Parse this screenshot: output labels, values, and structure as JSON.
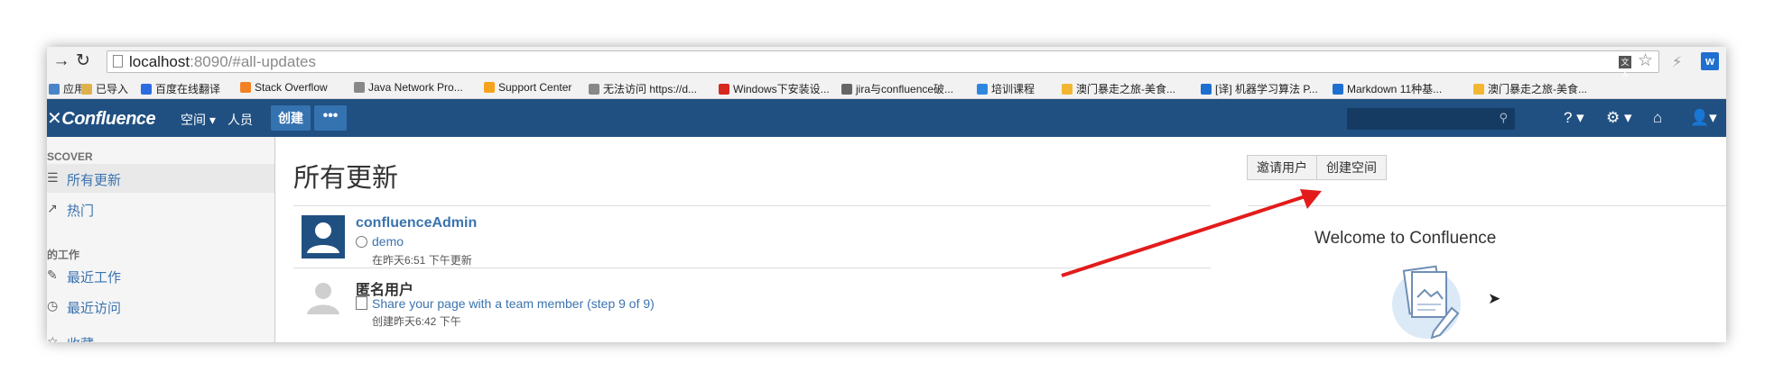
{
  "browser": {
    "url_host": "localhost",
    "url_path": ":8090/#all-updates",
    "translate_icon": "文A",
    "bookmarks": [
      {
        "label": "应用",
        "icon": "apps-icon",
        "color": "#4a86c7"
      },
      {
        "label": "已导入",
        "icon": "folder-icon",
        "color": "#e0b14a"
      },
      {
        "label": "百度在线翻译",
        "icon": "baidu-translate-icon",
        "color": "#2b6de0"
      },
      {
        "label": "Stack Overflow",
        "icon": "stackoverflow-icon",
        "color": "#f48024"
      },
      {
        "label": "Java Network Pro...",
        "icon": "page-icon",
        "color": "#888888"
      },
      {
        "label": "Support Center",
        "icon": "support-icon",
        "color": "#f7a21b"
      },
      {
        "label": "无法访问 https://d...",
        "icon": "page-icon",
        "color": "#888888"
      },
      {
        "label": "Windows下安装设...",
        "icon": "weibo-icon",
        "color": "#d6281f"
      },
      {
        "label": "jira与confluence破...",
        "icon": "bird-icon",
        "color": "#666666"
      },
      {
        "label": "培训课程",
        "icon": "course-icon",
        "color": "#2f86e0"
      },
      {
        "label": "澳门暴走之旅-美食...",
        "icon": "travel-icon",
        "color": "#f2b632"
      },
      {
        "label": "[译] 机器学习算法 P...",
        "icon": "article-icon",
        "color": "#1f6fd0"
      },
      {
        "label": "Markdown 11种基...",
        "icon": "markdown-icon",
        "color": "#1f6fd0"
      },
      {
        "label": "澳门暴走之旅-美食...",
        "icon": "travel-icon",
        "color": "#f2b632"
      }
    ]
  },
  "header": {
    "logo": "Confluence",
    "nav": {
      "spaces": "空间 ▾",
      "people": "人员"
    },
    "create": "创建",
    "more": "•••",
    "search_placeholder": ""
  },
  "sidebar": {
    "discover": "SCOVER",
    "items": [
      {
        "label": "所有更新",
        "icon": "list-icon",
        "glyph": "☰",
        "selected": true
      },
      {
        "label": "热门",
        "icon": "trending-icon",
        "glyph": "↗",
        "selected": false
      }
    ],
    "my_work": "的工作",
    "work_items": [
      {
        "label": "最近工作",
        "icon": "pencil-icon",
        "glyph": "✎"
      },
      {
        "label": "最近访问",
        "icon": "clock-icon",
        "glyph": "◷"
      }
    ],
    "cutoff": "收藏"
  },
  "main": {
    "title": "所有更新",
    "invite_button": "邀请用户",
    "create_space_button": "创建空间",
    "welcome": "Welcome to Confluence",
    "feed": [
      {
        "user": "confluenceAdmin",
        "sub": "demo",
        "time": "在昨天6:51 下午更新"
      },
      {
        "user": "匿名用户",
        "sub": "Share your page with a team member (step 9 of 9)",
        "time": "创建昨天6:42 下午"
      }
    ]
  },
  "colors": {
    "header": "#205081",
    "link": "#3b73af",
    "arrow": "#e31b1b"
  }
}
